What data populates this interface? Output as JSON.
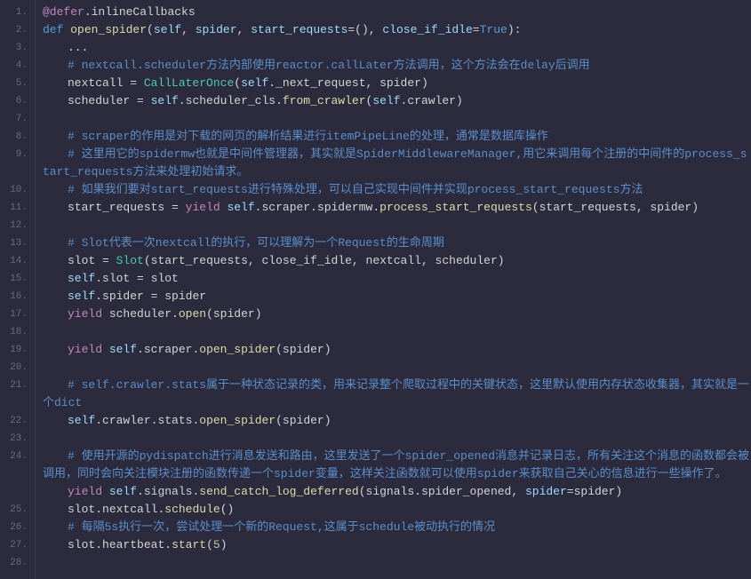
{
  "lines": [
    {
      "n": "1.",
      "tall": false,
      "tokens": [
        {
          "t": "@defer",
          "c": "tok-decorator"
        },
        {
          "t": ".",
          "c": "tok-punc"
        },
        {
          "t": "inlineCallbacks",
          "c": "tok-ident"
        }
      ],
      "indent": 1
    },
    {
      "n": "2.",
      "tall": false,
      "tokens": [
        {
          "t": "def ",
          "c": "tok-def"
        },
        {
          "t": "open_spider",
          "c": "tok-fnname"
        },
        {
          "t": "(",
          "c": "tok-paren"
        },
        {
          "t": "self",
          "c": "tok-self"
        },
        {
          "t": ", ",
          "c": "tok-punc"
        },
        {
          "t": "spider",
          "c": "tok-param"
        },
        {
          "t": ", ",
          "c": "tok-punc"
        },
        {
          "t": "start_requests",
          "c": "tok-param"
        },
        {
          "t": "=",
          "c": "tok-op"
        },
        {
          "t": "()",
          "c": "tok-paren"
        },
        {
          "t": ", ",
          "c": "tok-punc"
        },
        {
          "t": "close_if_idle",
          "c": "tok-param"
        },
        {
          "t": "=",
          "c": "tok-op"
        },
        {
          "t": "True",
          "c": "tok-bool"
        },
        {
          "t": ")",
          "c": "tok-paren"
        },
        {
          "t": ":",
          "c": "tok-punc"
        }
      ],
      "indent": 1
    },
    {
      "n": "3.",
      "tall": false,
      "tokens": [
        {
          "t": "...",
          "c": "tok-punc"
        }
      ],
      "indent": 2
    },
    {
      "n": "4.",
      "tall": false,
      "tokens": [
        {
          "t": "# nextcall.scheduler方法内部使用reactor.callLater方法调用，这个方法会在delay后调用",
          "c": "tok-comment"
        }
      ],
      "indent": 2
    },
    {
      "n": "5.",
      "tall": false,
      "tokens": [
        {
          "t": "nextcall ",
          "c": "tok-ident"
        },
        {
          "t": "= ",
          "c": "tok-op"
        },
        {
          "t": "CallLaterOnce",
          "c": "tok-class"
        },
        {
          "t": "(",
          "c": "tok-paren"
        },
        {
          "t": "self",
          "c": "tok-self"
        },
        {
          "t": ".",
          "c": "tok-punc"
        },
        {
          "t": "_next_request",
          "c": "tok-attr"
        },
        {
          "t": ", ",
          "c": "tok-punc"
        },
        {
          "t": "spider",
          "c": "tok-ident"
        },
        {
          "t": ")",
          "c": "tok-paren"
        }
      ],
      "indent": 2
    },
    {
      "n": "6.",
      "tall": false,
      "tokens": [
        {
          "t": "scheduler ",
          "c": "tok-ident"
        },
        {
          "t": "= ",
          "c": "tok-op"
        },
        {
          "t": "self",
          "c": "tok-self"
        },
        {
          "t": ".",
          "c": "tok-punc"
        },
        {
          "t": "scheduler_cls",
          "c": "tok-attr"
        },
        {
          "t": ".",
          "c": "tok-punc"
        },
        {
          "t": "from_crawler",
          "c": "tok-call"
        },
        {
          "t": "(",
          "c": "tok-paren"
        },
        {
          "t": "self",
          "c": "tok-self"
        },
        {
          "t": ".",
          "c": "tok-punc"
        },
        {
          "t": "crawler",
          "c": "tok-attr"
        },
        {
          "t": ")",
          "c": "tok-paren"
        }
      ],
      "indent": 2
    },
    {
      "n": "7.",
      "tall": false,
      "tokens": [],
      "indent": 2
    },
    {
      "n": "8.",
      "tall": false,
      "tokens": [
        {
          "t": "# scraper的作用是对下载的网页的解析结果进行itemPipeLine的处理，通常是数据库操作",
          "c": "tok-comment"
        }
      ],
      "indent": 2
    },
    {
      "n": "9.",
      "tall": true,
      "tokens": [
        {
          "t": "# 这里用它的spidermw也就是中间件管理器，其实就是SpiderMiddlewareManager,用它来调用每个注册的中间件的process_start_requests方法来处理初始请求。",
          "c": "tok-comment"
        }
      ],
      "indent": 2
    },
    {
      "n": "10.",
      "tall": false,
      "tokens": [
        {
          "t": "# 如果我们要对start_requests进行特殊处理，可以自己实现中间件并实现process_start_requests方法",
          "c": "tok-comment"
        }
      ],
      "indent": 2
    },
    {
      "n": "11.",
      "tall": false,
      "tokens": [
        {
          "t": "start_requests ",
          "c": "tok-ident"
        },
        {
          "t": "= ",
          "c": "tok-op"
        },
        {
          "t": "yield ",
          "c": "tok-yield"
        },
        {
          "t": "self",
          "c": "tok-self"
        },
        {
          "t": ".",
          "c": "tok-punc"
        },
        {
          "t": "scraper",
          "c": "tok-attr"
        },
        {
          "t": ".",
          "c": "tok-punc"
        },
        {
          "t": "spidermw",
          "c": "tok-attr"
        },
        {
          "t": ".",
          "c": "tok-punc"
        },
        {
          "t": "process_start_requests",
          "c": "tok-call"
        },
        {
          "t": "(",
          "c": "tok-paren"
        },
        {
          "t": "start_requests",
          "c": "tok-ident"
        },
        {
          "t": ", ",
          "c": "tok-punc"
        },
        {
          "t": "spider",
          "c": "tok-ident"
        },
        {
          "t": ")",
          "c": "tok-paren"
        }
      ],
      "indent": 2
    },
    {
      "n": "12.",
      "tall": false,
      "tokens": [],
      "indent": 2
    },
    {
      "n": "13.",
      "tall": false,
      "tokens": [
        {
          "t": "# Slot代表一次nextcall的执行，可以理解为一个Request的生命周期",
          "c": "tok-comment"
        }
      ],
      "indent": 2
    },
    {
      "n": "14.",
      "tall": false,
      "tokens": [
        {
          "t": "slot ",
          "c": "tok-ident"
        },
        {
          "t": "= ",
          "c": "tok-op"
        },
        {
          "t": "Slot",
          "c": "tok-class"
        },
        {
          "t": "(",
          "c": "tok-paren"
        },
        {
          "t": "start_requests",
          "c": "tok-ident"
        },
        {
          "t": ", ",
          "c": "tok-punc"
        },
        {
          "t": "close_if_idle",
          "c": "tok-ident"
        },
        {
          "t": ", ",
          "c": "tok-punc"
        },
        {
          "t": "nextcall",
          "c": "tok-ident"
        },
        {
          "t": ", ",
          "c": "tok-punc"
        },
        {
          "t": "scheduler",
          "c": "tok-ident"
        },
        {
          "t": ")",
          "c": "tok-paren"
        }
      ],
      "indent": 2
    },
    {
      "n": "15.",
      "tall": false,
      "tokens": [
        {
          "t": "self",
          "c": "tok-self"
        },
        {
          "t": ".",
          "c": "tok-punc"
        },
        {
          "t": "slot ",
          "c": "tok-attr"
        },
        {
          "t": "= ",
          "c": "tok-op"
        },
        {
          "t": "slot",
          "c": "tok-ident"
        }
      ],
      "indent": 2
    },
    {
      "n": "16.",
      "tall": false,
      "tokens": [
        {
          "t": "self",
          "c": "tok-self"
        },
        {
          "t": ".",
          "c": "tok-punc"
        },
        {
          "t": "spider ",
          "c": "tok-attr"
        },
        {
          "t": "= ",
          "c": "tok-op"
        },
        {
          "t": "spider",
          "c": "tok-ident"
        }
      ],
      "indent": 2
    },
    {
      "n": "17.",
      "tall": false,
      "tokens": [
        {
          "t": "yield ",
          "c": "tok-yield"
        },
        {
          "t": "scheduler",
          "c": "tok-ident"
        },
        {
          "t": ".",
          "c": "tok-punc"
        },
        {
          "t": "open",
          "c": "tok-call"
        },
        {
          "t": "(",
          "c": "tok-paren"
        },
        {
          "t": "spider",
          "c": "tok-ident"
        },
        {
          "t": ")",
          "c": "tok-paren"
        }
      ],
      "indent": 2
    },
    {
      "n": "18.",
      "tall": false,
      "tokens": [],
      "indent": 2
    },
    {
      "n": "19.",
      "tall": false,
      "tokens": [
        {
          "t": "yield ",
          "c": "tok-yield"
        },
        {
          "t": "self",
          "c": "tok-self"
        },
        {
          "t": ".",
          "c": "tok-punc"
        },
        {
          "t": "scraper",
          "c": "tok-attr"
        },
        {
          "t": ".",
          "c": "tok-punc"
        },
        {
          "t": "open_spider",
          "c": "tok-call"
        },
        {
          "t": "(",
          "c": "tok-paren"
        },
        {
          "t": "spider",
          "c": "tok-ident"
        },
        {
          "t": ")",
          "c": "tok-paren"
        }
      ],
      "indent": 2
    },
    {
      "n": "20.",
      "tall": false,
      "tokens": [],
      "indent": 2
    },
    {
      "n": "21.",
      "tall": true,
      "tokens": [
        {
          "t": "# self.crawler.stats属于一种状态记录的类，用来记录整个爬取过程中的关键状态，这里默认使用内存状态收集器，其实就是一个dict",
          "c": "tok-comment"
        }
      ],
      "indent": 2
    },
    {
      "n": "22.",
      "tall": false,
      "tokens": [
        {
          "t": "self",
          "c": "tok-self"
        },
        {
          "t": ".",
          "c": "tok-punc"
        },
        {
          "t": "crawler",
          "c": "tok-attr"
        },
        {
          "t": ".",
          "c": "tok-punc"
        },
        {
          "t": "stats",
          "c": "tok-attr"
        },
        {
          "t": ".",
          "c": "tok-punc"
        },
        {
          "t": "open_spider",
          "c": "tok-call"
        },
        {
          "t": "(",
          "c": "tok-paren"
        },
        {
          "t": "spider",
          "c": "tok-ident"
        },
        {
          "t": ")",
          "c": "tok-paren"
        }
      ],
      "indent": 2
    },
    {
      "n": "23.",
      "tall": false,
      "tokens": [],
      "indent": 2
    },
    {
      "n": "24.",
      "tall": true,
      "tokens": [
        {
          "t": "# 使用开源的pydispatch进行消息发送和路由，这里发送了一个spider_opened消息并记录日志，所有关注这个消息的函数都会被调用，同时会向关注模块注册的函数传递一个spider变量，这样关注函数就可以使用spider来获取自己关心的信息进行一些操作了。",
          "c": "tok-comment"
        }
      ],
      "indent": 2
    },
    {
      "n": "25.",
      "tall": false,
      "tokens": [
        {
          "t": "yield ",
          "c": "tok-yield"
        },
        {
          "t": "self",
          "c": "tok-self"
        },
        {
          "t": ".",
          "c": "tok-punc"
        },
        {
          "t": "signals",
          "c": "tok-attr"
        },
        {
          "t": ".",
          "c": "tok-punc"
        },
        {
          "t": "send_catch_log_deferred",
          "c": "tok-call"
        },
        {
          "t": "(",
          "c": "tok-paren"
        },
        {
          "t": "signals",
          "c": "tok-ident"
        },
        {
          "t": ".",
          "c": "tok-punc"
        },
        {
          "t": "spider_opened",
          "c": "tok-attr"
        },
        {
          "t": ", ",
          "c": "tok-punc"
        },
        {
          "t": "spider",
          "c": "tok-param"
        },
        {
          "t": "=",
          "c": "tok-op"
        },
        {
          "t": "spider",
          "c": "tok-ident"
        },
        {
          "t": ")",
          "c": "tok-paren"
        }
      ],
      "indent": 2
    },
    {
      "n": "26.",
      "tall": false,
      "tokens": [
        {
          "t": "slot",
          "c": "tok-ident"
        },
        {
          "t": ".",
          "c": "tok-punc"
        },
        {
          "t": "nextcall",
          "c": "tok-attr"
        },
        {
          "t": ".",
          "c": "tok-punc"
        },
        {
          "t": "schedule",
          "c": "tok-call"
        },
        {
          "t": "()",
          "c": "tok-paren"
        }
      ],
      "indent": 2
    },
    {
      "n": "27.",
      "tall": false,
      "tokens": [
        {
          "t": "# 每隔5s执行一次，尝试处理一个新的Request,这属于schedule被动执行的情况",
          "c": "tok-comment"
        }
      ],
      "indent": 2
    },
    {
      "n": "28.",
      "tall": false,
      "tokens": [
        {
          "t": "slot",
          "c": "tok-ident"
        },
        {
          "t": ".",
          "c": "tok-punc"
        },
        {
          "t": "heartbeat",
          "c": "tok-attr"
        },
        {
          "t": ".",
          "c": "tok-punc"
        },
        {
          "t": "start",
          "c": "tok-call"
        },
        {
          "t": "(",
          "c": "tok-paren"
        },
        {
          "t": "5",
          "c": "tok-num"
        },
        {
          "t": ")",
          "c": "tok-paren"
        }
      ],
      "indent": 2
    }
  ]
}
